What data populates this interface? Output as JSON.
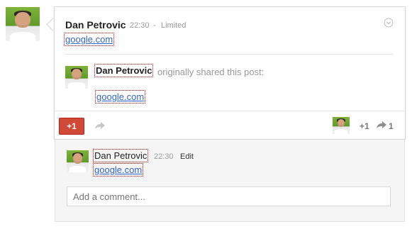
{
  "post": {
    "author": "Dan Petrovic",
    "time": "22:30",
    "separator": "-",
    "visibility": "Limited",
    "link": "google.com",
    "reshare": {
      "author": "Dan Petrovic",
      "text": "originally shared this post:",
      "link": "google.com"
    }
  },
  "actions": {
    "plus_one_label": "+1",
    "plus_count": "+1",
    "share_count": "1"
  },
  "comment": {
    "author": "Dan Petrovic",
    "time": "22:30",
    "edit_label": "Edit",
    "link": "google.com"
  },
  "comment_input": {
    "placeholder": "Add a comment..."
  },
  "icons": {
    "menu": "chevron-down-circle-icon",
    "share": "share-arrow-icon",
    "reshare_count": "reshare-arrow-icon"
  },
  "colors": {
    "plus_one": "#d14836",
    "link": "#3366cc",
    "meta": "#999999"
  }
}
